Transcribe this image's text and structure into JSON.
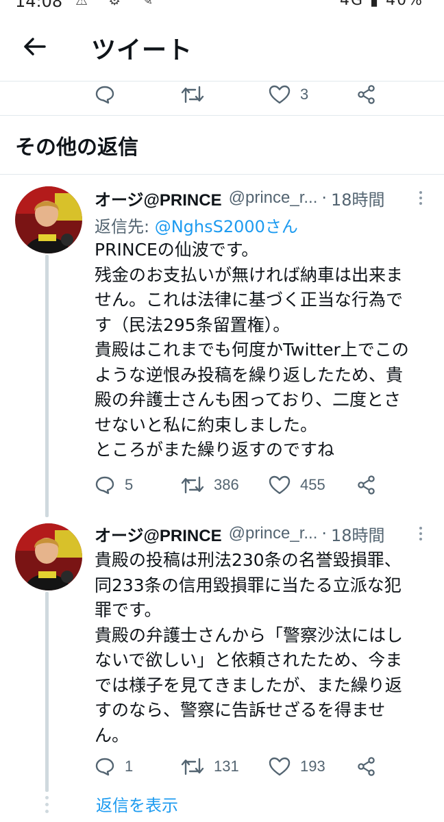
{
  "status_bar": {
    "time": "14:08",
    "right": "4G  ▮ 40%"
  },
  "header": {
    "title": "ツイート"
  },
  "main_tweet_actions": {
    "like_count": "3"
  },
  "section": {
    "title": "その他の返信"
  },
  "replies": [
    {
      "name": "オージ@PRINCE",
      "handle": "@prince_r...",
      "time": "18時間",
      "reply_to_prefix": "返信先: ",
      "reply_to_user": "@NghsS2000さん",
      "lines": [
        "PRINCEの仙波です。",
        "残金のお支払いが無ければ納車は出来ま",
        "せん。これは法律に基づく正当な行為で",
        "す（民法295条留置権）。",
        "貴殿はこれまでも何度かTwitter上でこの",
        "ような逆恨み投稿を繰り返したため、貴",
        "殿の弁護士さんも困っており、二度とさ",
        "せないと私に約束しました。",
        "ところがまた繰り返すのですね"
      ],
      "reply_count": "5",
      "retweet_count": "386",
      "like_count": "455"
    },
    {
      "name": "オージ@PRINCE",
      "handle": "@prince_r...",
      "time": "18時間",
      "lines": [
        "貴殿の投稿は刑法230条の名誉毀損罪、",
        "同233条の信用毀損罪に当たる立派な犯",
        "罪です。",
        "貴殿の弁護士さんから「警察沙汰にはし",
        "ないで欲しい」と依頼されたため、今ま",
        "では様子を見てきましたが、また繰り返",
        "すのなら、警察に告訴せざるを得ませ",
        "ん。"
      ],
      "reply_count": "1",
      "retweet_count": "131",
      "like_count": "193"
    }
  ],
  "show_replies_label": "返信を表示",
  "colors": {
    "accent": "#1d9bf0",
    "muted": "#536471",
    "divider": "#e1e8ed"
  }
}
